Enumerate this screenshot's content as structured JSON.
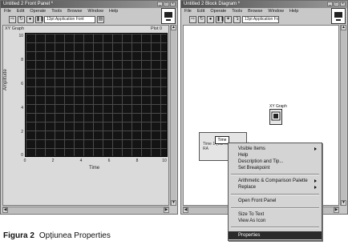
{
  "front_panel": {
    "title": "Untitled 2 Front Panel *",
    "menu": [
      "File",
      "Edit",
      "Operate",
      "Tools",
      "Browse",
      "Window",
      "Help"
    ],
    "font_select": "13pt Application Font",
    "graph_label": "XY Graph",
    "plot_legend": "Plot 0",
    "y_axis_label": "Amplitude",
    "x_axis_label": "Time",
    "y_ticks": [
      "10",
      "8",
      "6",
      "4",
      "2",
      "0"
    ],
    "x_ticks": [
      "0",
      "2",
      "4",
      "6",
      "8",
      "10"
    ]
  },
  "block_diagram": {
    "title": "Untitled 2 Block Diagram *",
    "menu": [
      "File",
      "Edit",
      "Operate",
      "Tools",
      "Browse",
      "Window",
      "Help"
    ],
    "font_select": "13pt Application Font",
    "terminal_label": "XY Graph",
    "node_label": "Time",
    "wire_label_lines": [
      "Time 1 (Var ...",
      "RA"
    ]
  },
  "context_menu": {
    "items": [
      {
        "label": "Visible Items",
        "submenu": true,
        "selected": false
      },
      {
        "label": "Help",
        "submenu": false,
        "selected": false
      },
      {
        "label": "Description and Tip...",
        "submenu": false,
        "selected": false
      },
      {
        "label": "Set Breakpoint",
        "submenu": false,
        "selected": false
      },
      {
        "label": "Arithmetic & Comparison Palette",
        "submenu": true,
        "selected": false
      },
      {
        "label": "Replace",
        "submenu": true,
        "selected": false
      },
      {
        "label": "Open Front Panel",
        "submenu": false,
        "selected": false
      },
      {
        "label": "Size To Text",
        "submenu": false,
        "selected": false
      },
      {
        "label": "View As Icon",
        "submenu": false,
        "selected": false
      },
      {
        "label": "Properties",
        "submenu": false,
        "selected": true
      }
    ]
  },
  "caption": {
    "figure": "Figura 2",
    "text": "Opțiunea Properties"
  }
}
